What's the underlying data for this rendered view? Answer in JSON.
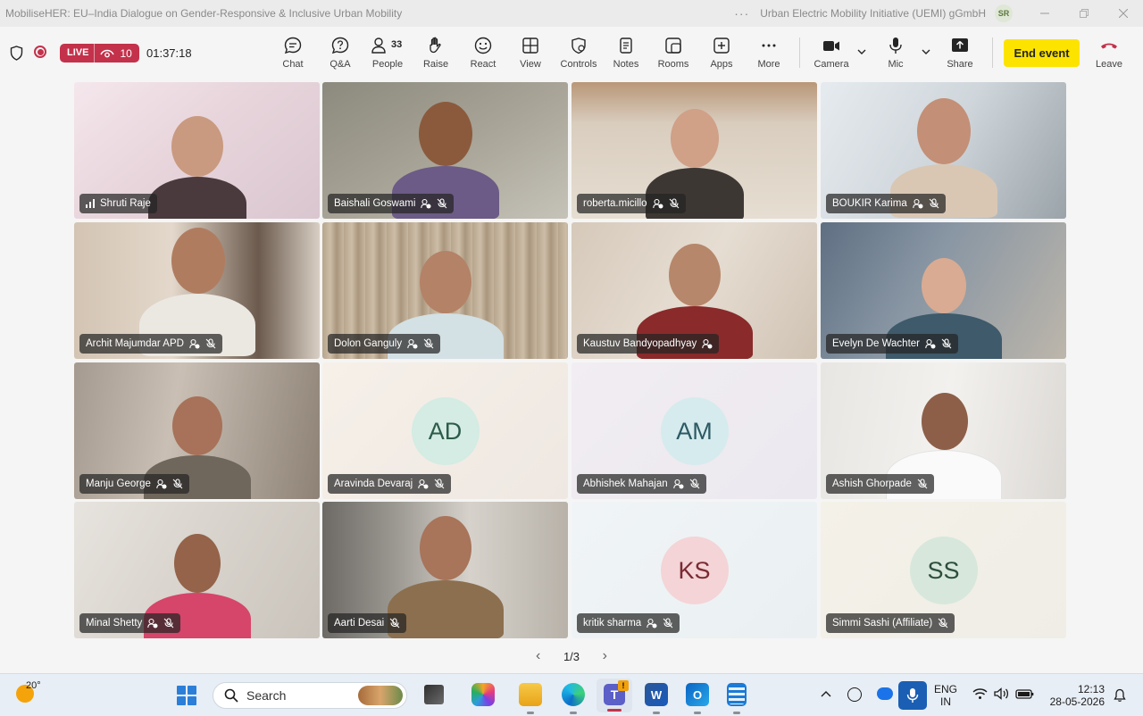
{
  "window": {
    "title": "MobiliseHER: EU–India Dialogue on Gender-Responsive & Inclusive Urban Mobility",
    "org": "Urban Electric Mobility Initiative (UEMI) gGmbH",
    "avatar_initials": "SR",
    "more": "···"
  },
  "meeting": {
    "live_label": "LIVE",
    "viewer_count": "10",
    "elapsed": "01:37:18"
  },
  "toolbar": {
    "chat": "Chat",
    "qa": "Q&A",
    "people": "People",
    "people_count": "33",
    "raise": "Raise",
    "react": "React",
    "view": "View",
    "controls": "Controls",
    "notes": "Notes",
    "rooms": "Rooms",
    "apps": "Apps",
    "more": "More",
    "camera": "Camera",
    "mic": "Mic",
    "share": "Share",
    "end_event": "End event",
    "leave": "Leave"
  },
  "participants": [
    {
      "name": "Shruti Raje",
      "initials": "",
      "video": true,
      "speaking": true
    },
    {
      "name": "Baishali Goswami",
      "initials": "",
      "video": true
    },
    {
      "name": "roberta.micillo",
      "initials": "",
      "video": true
    },
    {
      "name": "BOUKIR Karima",
      "initials": "",
      "video": true
    },
    {
      "name": "Archit Majumdar APD",
      "initials": "",
      "video": true
    },
    {
      "name": "Dolon Ganguly",
      "initials": "",
      "video": true
    },
    {
      "name": "Kaustuv Bandyopadhyay",
      "initials": "",
      "video": true
    },
    {
      "name": "Evelyn De Wachter",
      "initials": "",
      "video": true
    },
    {
      "name": "Manju George",
      "initials": "",
      "video": true
    },
    {
      "name": "Aravinda Devaraj",
      "initials": "AD",
      "video": false
    },
    {
      "name": "Abhishek Mahajan",
      "initials": "AM",
      "video": false
    },
    {
      "name": "Ashish Ghorpade",
      "initials": "",
      "video": true
    },
    {
      "name": "Minal Shetty",
      "initials": "",
      "video": true
    },
    {
      "name": "Aarti Desai",
      "initials": "",
      "video": true
    },
    {
      "name": "kritik sharma",
      "initials": "KS",
      "video": false
    },
    {
      "name": "Simmi Sashi (Affiliate)",
      "initials": "SS",
      "video": false
    }
  ],
  "pager": {
    "text": "1/3"
  },
  "taskbar": {
    "temperature": "20°",
    "search": "Search",
    "lang_top": "ENG",
    "lang_bottom": "IN",
    "time": "12:13",
    "date": "28-05-2026"
  },
  "colors": {
    "live_red": "#c4314b",
    "end_event_yellow": "#fde300",
    "leave_red": "#c4314b",
    "ad_avatar": "#d4ece3",
    "am_avatar": "#d6ebee",
    "ks_avatar": "#f4d4d6",
    "ss_avatar": "#d7e7dc"
  }
}
